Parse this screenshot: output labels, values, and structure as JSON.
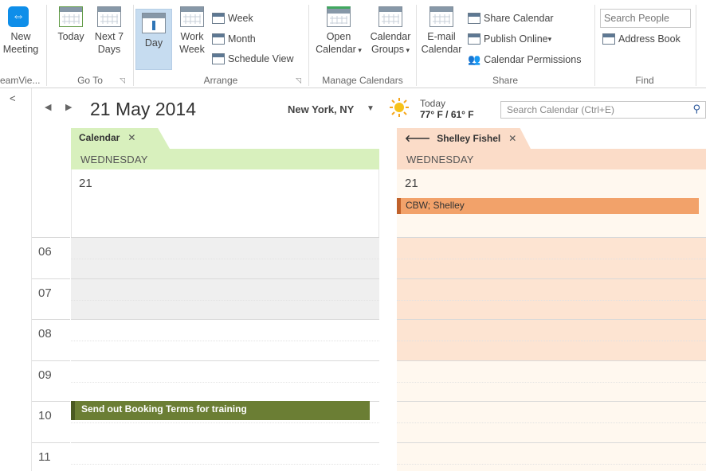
{
  "ribbon": {
    "teamviewer": {
      "line1": "New",
      "line2": "Meeting",
      "group": "eamVie..."
    },
    "goto": {
      "today": "Today",
      "next7_line1": "Next 7",
      "next7_line2": "Days",
      "group": "Go To"
    },
    "arrange": {
      "day": "Day",
      "workweek_line1": "Work",
      "workweek_line2": "Week",
      "week": "Week",
      "month": "Month",
      "schedule": "Schedule View",
      "group": "Arrange"
    },
    "manage": {
      "open_line1": "Open",
      "open_line2": "Calendar",
      "groups_line1": "Calendar",
      "groups_line2": "Groups",
      "group": "Manage Calendars"
    },
    "share": {
      "email_line1": "E-mail",
      "email_line2": "Calendar",
      "share_calendar": "Share Calendar",
      "publish_online": "Publish Online",
      "permissions": "Calendar Permissions",
      "group": "Share"
    },
    "find": {
      "search_people_placeholder": "Search People",
      "address_book": "Address Book",
      "group": "Find"
    }
  },
  "header": {
    "collapse_glyph": "<",
    "date_title": "21 May 2014",
    "location": "New York, NY",
    "weather_label": "Today",
    "weather_temp": "77° F / 61° F",
    "search_placeholder": "Search Calendar (Ctrl+E)"
  },
  "calendars": [
    {
      "tab": "Calendar",
      "day_name": "WEDNESDAY",
      "day_number": "21",
      "color": "#d8f0bd",
      "event": {
        "title": "Send out Booking Terms for training",
        "color": "#6b7e34",
        "hour": "10"
      }
    },
    {
      "tab": "Shelley Fishel",
      "day_name": "WEDNESDAY",
      "day_number": "21",
      "color": "#fbdcc8",
      "allday_event": {
        "title": "CBW; Shelley",
        "color": "#f2a26a"
      }
    }
  ],
  "hours": [
    "06",
    "07",
    "08",
    "09",
    "10",
    "11"
  ]
}
